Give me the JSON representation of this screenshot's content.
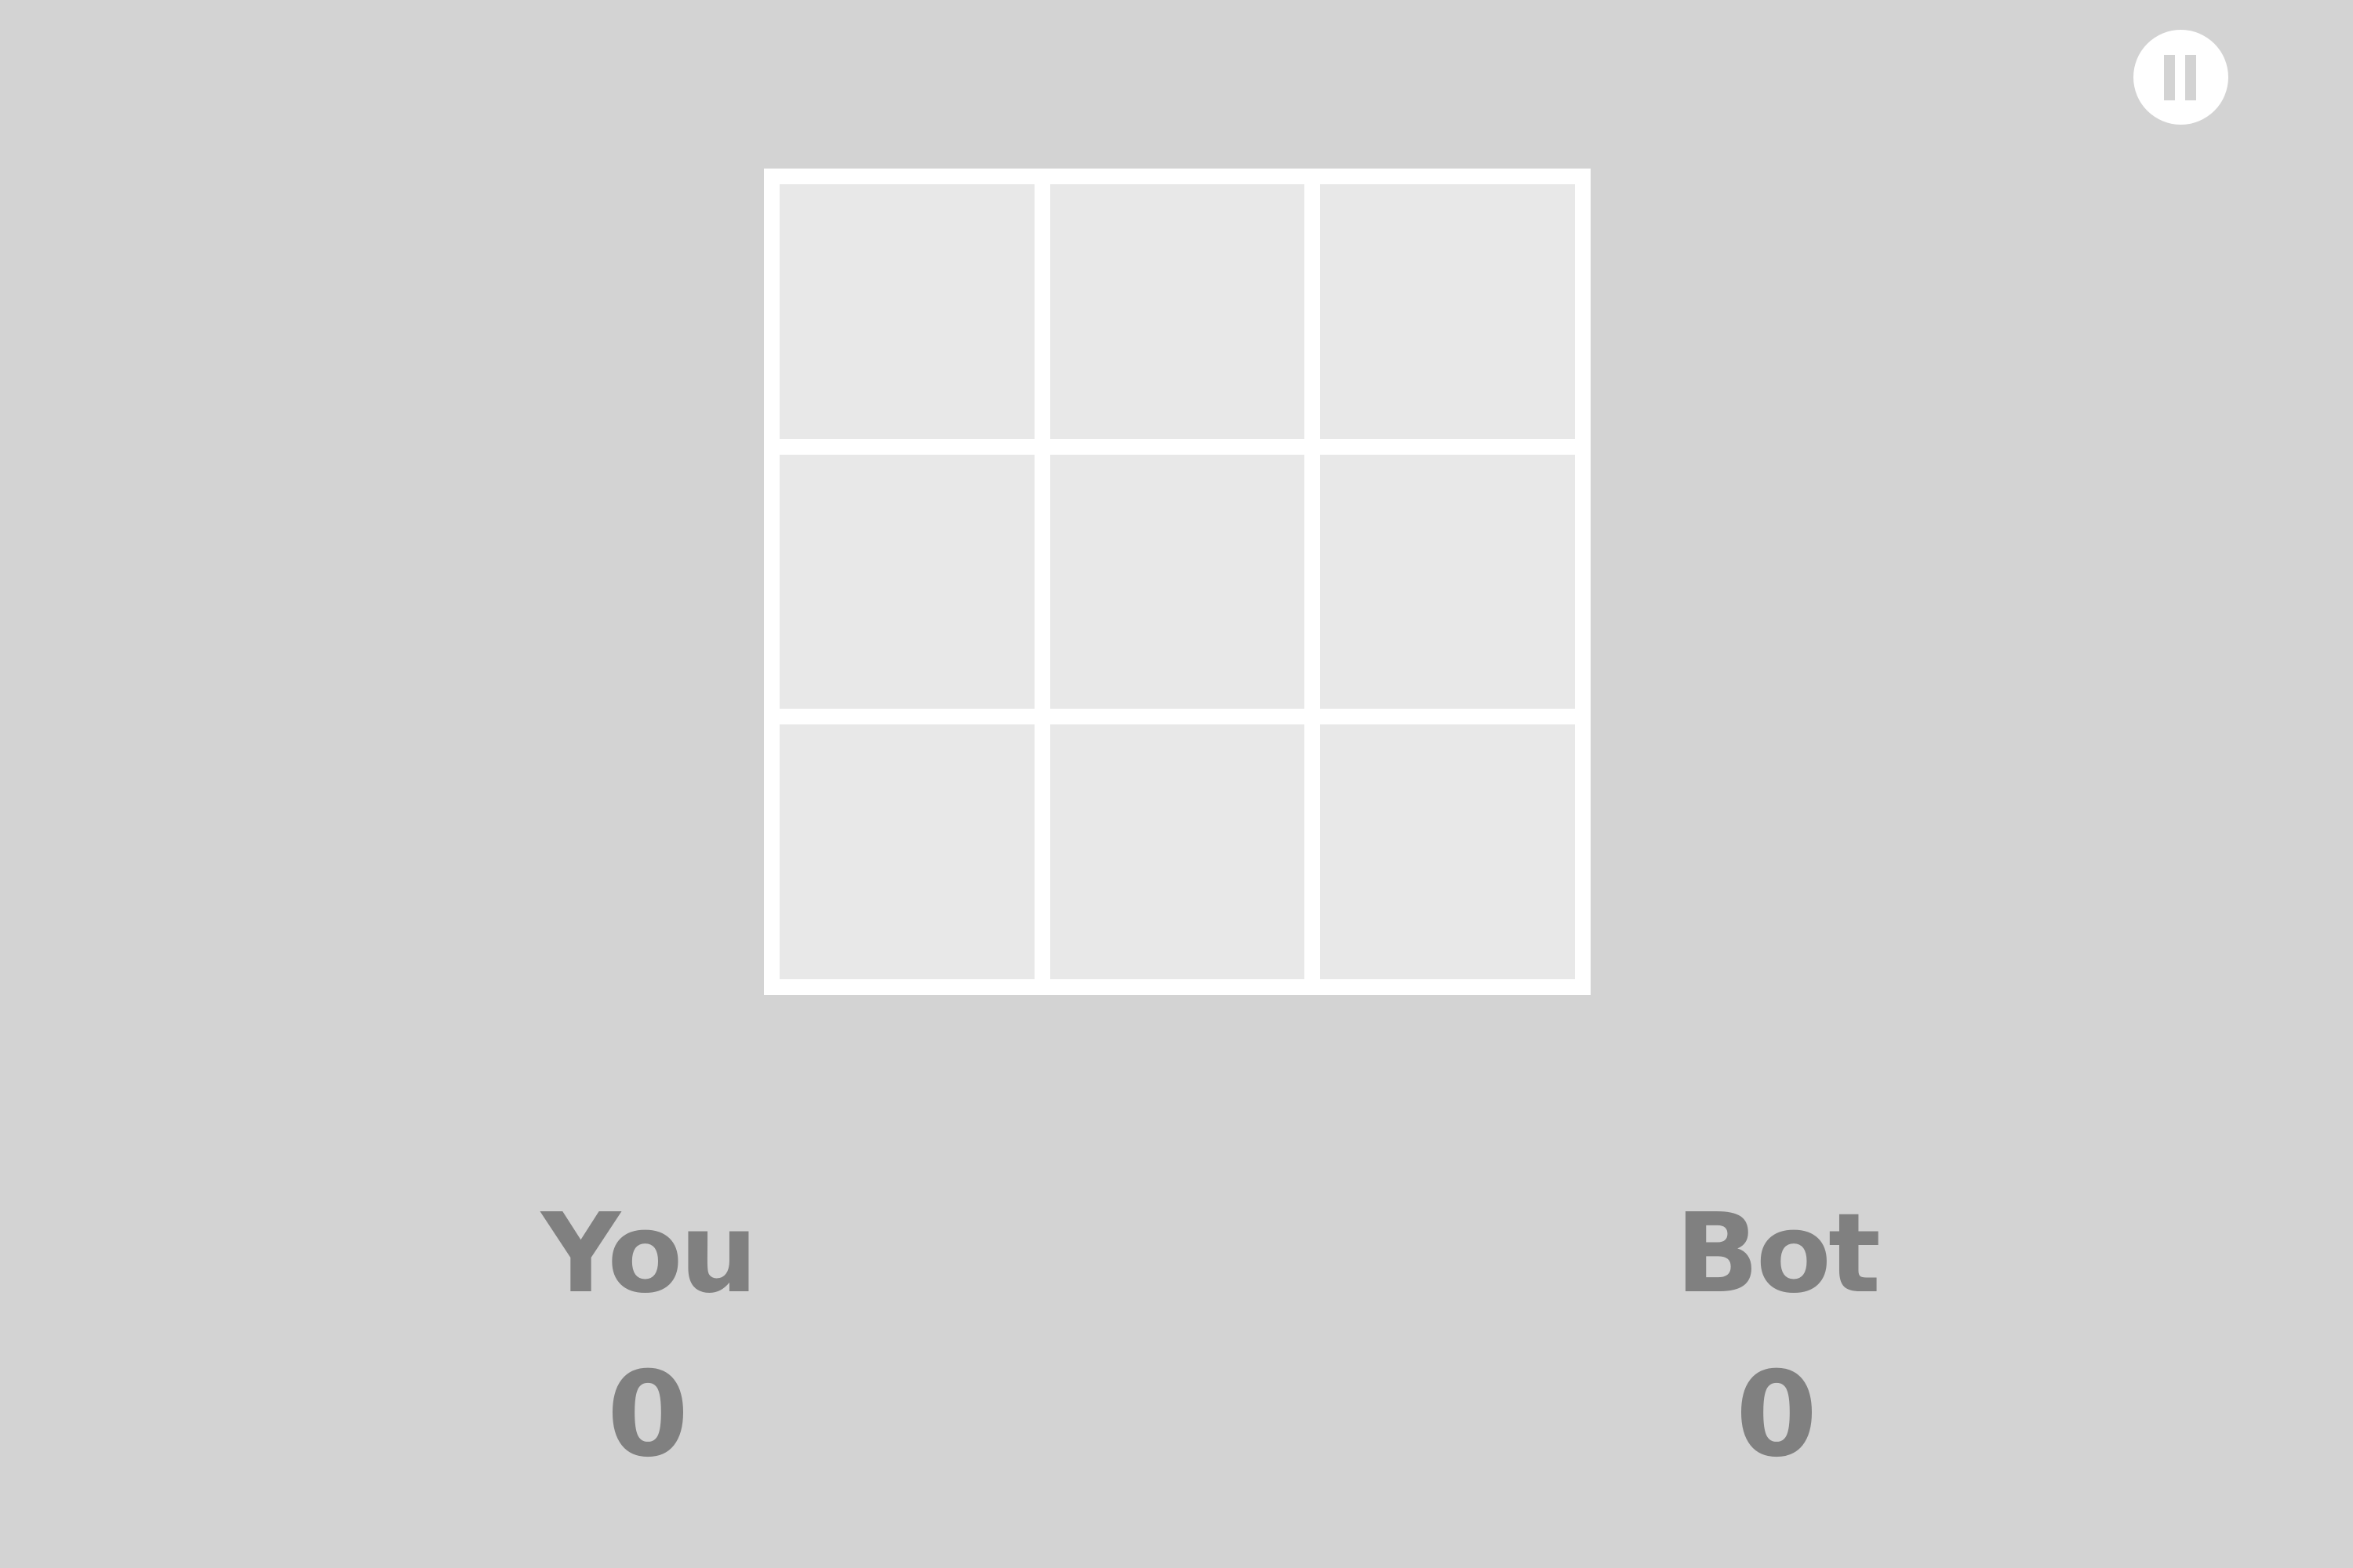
{
  "board": {
    "cells": [
      "",
      "",
      "",
      "",
      "",
      "",
      "",
      "",
      ""
    ]
  },
  "scoreboard": {
    "player": {
      "label": "You",
      "score": "0"
    },
    "bot": {
      "label": "Bot",
      "score": "0"
    }
  },
  "pause_button": {
    "icon": "pause-icon"
  },
  "colors": {
    "background": "#d3d3d3",
    "board_lines": "#ffffff",
    "cell_fill": "#e8e8e8",
    "text": "#808080"
  }
}
